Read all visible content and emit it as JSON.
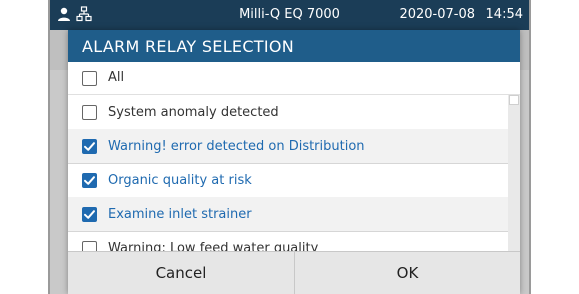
{
  "status_bar": {
    "title": "Milli-Q EQ 7000",
    "date": "2020-07-08",
    "time": "14:54",
    "icons": [
      "user-icon",
      "network-icon"
    ]
  },
  "dialog": {
    "title": "ALARM RELAY SELECTION",
    "all_label": "All",
    "all_checked": false,
    "items": [
      {
        "label": "System anomaly detected",
        "checked": false
      },
      {
        "label": "Warning! error detected on Distribution",
        "checked": true
      },
      {
        "label": "Organic quality at risk",
        "checked": true
      },
      {
        "label": "Examine inlet strainer",
        "checked": true
      },
      {
        "label": "Warning: Low feed water quality",
        "checked": false
      }
    ],
    "cancel_label": "Cancel",
    "ok_label": "OK"
  },
  "colors": {
    "status_bar_bg": "#1b3d57",
    "header_bg": "#1f5d8a",
    "checked_accent": "#1f6ab0"
  }
}
